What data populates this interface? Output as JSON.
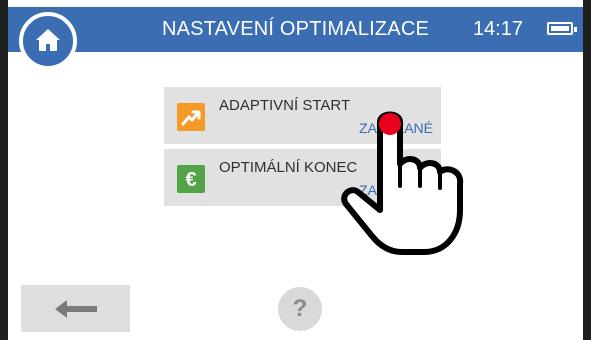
{
  "header": {
    "title": "NASTAVENÍ OPTIMALIZACE",
    "time": "14:17",
    "color": "#3a6db1"
  },
  "home_button": {
    "icon": "home-icon"
  },
  "settings": [
    {
      "label": "ADAPTIVNÍ START",
      "value": "ZAKÁZANÉ",
      "icon": "trend-up-icon",
      "icon_color": "#f39b26"
    },
    {
      "label": "OPTIMÁLNÍ KONEC",
      "value": "ZAKÁZANÉ",
      "icon": "euro-icon",
      "icon_color": "#53a447"
    }
  ],
  "footer": {
    "back_icon": "arrow-left-icon",
    "help_label": "?"
  },
  "overlay": {
    "icon": "pointing-hand-icon",
    "tap_color": "#e8001c"
  }
}
